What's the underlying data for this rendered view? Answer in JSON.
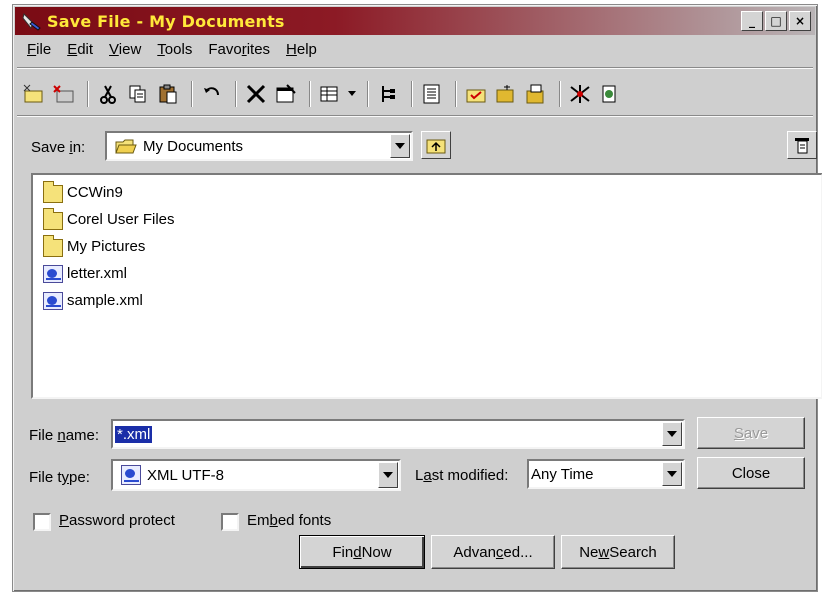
{
  "window": {
    "title": "Save File - My Documents",
    "controls": {
      "minimize": "_",
      "maximize": "□",
      "close": "×"
    }
  },
  "menu": [
    {
      "label": "File",
      "underline": "F",
      "rest": "ile"
    },
    {
      "label": "Edit",
      "underline": "E",
      "rest": "dit"
    },
    {
      "label": "View",
      "underline": "V",
      "rest": "iew"
    },
    {
      "label": "Tools",
      "underline": "T",
      "rest": "ools"
    },
    {
      "label": "Favorites",
      "pre": "Favo",
      "underline": "r",
      "rest": "ites"
    },
    {
      "label": "Help",
      "underline": "H",
      "rest": "elp"
    }
  ],
  "toolbar_icons": [
    "new-folder-icon",
    "delete-folder-icon",
    "cut-icon",
    "copy-icon",
    "paste-icon",
    "undo-icon",
    "delete-icon",
    "properties-icon",
    "views-icon",
    "tree-icon",
    "preview-icon",
    "check-folder-icon",
    "open-folder-icon",
    "map-drive-icon",
    "favorites-icon",
    "network-icon"
  ],
  "save_in": {
    "label_pre": "Save ",
    "label_ul": "i",
    "label_post": "n:",
    "value": "My Documents"
  },
  "files": [
    {
      "name": "CCWin9",
      "type": "folder"
    },
    {
      "name": "Corel User Files",
      "type": "folder"
    },
    {
      "name": "My Pictures",
      "type": "folder"
    },
    {
      "name": "letter.xml",
      "type": "xml"
    },
    {
      "name": "sample.xml",
      "type": "xml"
    }
  ],
  "file_name": {
    "label_pre": "File ",
    "label_ul": "n",
    "label_post": "ame:",
    "value": "*.xml"
  },
  "file_type": {
    "label_pre": "File t",
    "label_ul": "y",
    "label_post": "pe:",
    "value": "XML UTF-8"
  },
  "last_modified": {
    "label_pre": "L",
    "label_ul": "a",
    "label_post": "st modified:",
    "value": "Any Time"
  },
  "buttons": {
    "save": {
      "pre": "",
      "ul": "S",
      "post": "ave"
    },
    "close": "Close",
    "find_now": {
      "pre": "Fin",
      "ul": "d",
      "post": " Now"
    },
    "advanced": {
      "pre": "Advan",
      "ul": "c",
      "post": "ed..."
    },
    "new_search": {
      "pre": "Ne",
      "ul": "w",
      "post": " Search"
    }
  },
  "options": {
    "password": {
      "pre": "",
      "ul": "P",
      "post": "assword protect"
    },
    "embed": {
      "pre": "Em",
      "ul": "b",
      "post": "ed fonts"
    }
  }
}
